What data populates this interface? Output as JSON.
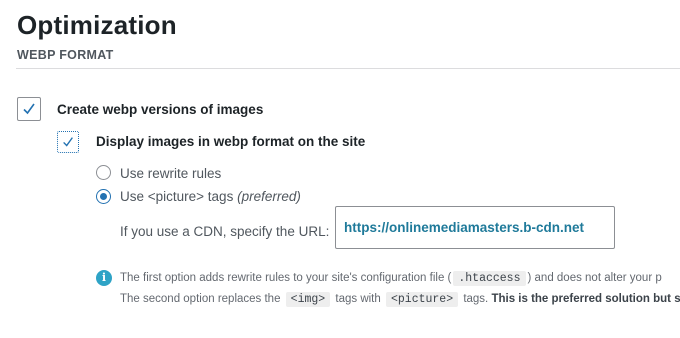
{
  "page": {
    "title": "Optimization"
  },
  "section": {
    "title": "WEBP FORMAT"
  },
  "options": {
    "create_webp": {
      "label": "Create webp versions of images",
      "checked": true
    },
    "display_webp": {
      "label": "Display images in webp format on the site",
      "checked": true
    }
  },
  "radios": {
    "rewrite": {
      "label": "Use rewrite rules",
      "selected": false
    },
    "picture": {
      "label": "Use <picture> tags",
      "note": "(preferred)",
      "selected": true
    }
  },
  "cdn": {
    "label": "If you use a CDN, specify the URL:",
    "value": "https://onlinemediamasters.b-cdn.net"
  },
  "info": {
    "line1_pre": "The first option adds rewrite rules to your site's configuration file (",
    "line1_code": ".htaccess",
    "line1_post": ") and does not alter your p",
    "line2_pre": "The second option replaces the",
    "line2_code1": "<img>",
    "line2_mid": "tags with",
    "line2_code2": "<picture>",
    "line2_post": "tags.",
    "line2_bold": "This is the preferred solution but s"
  },
  "colors": {
    "accent": "#2271b1",
    "info": "#2ea3c6",
    "url_text": "#1f7a9a"
  }
}
